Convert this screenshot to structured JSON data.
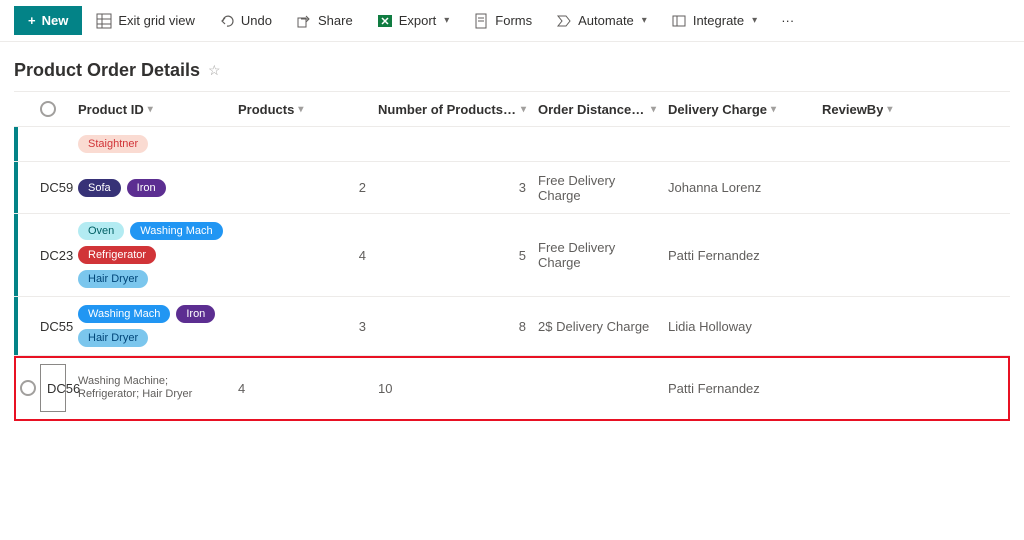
{
  "toolbar": {
    "new_label": "New",
    "exit_grid_view_label": "Exit grid view",
    "undo_label": "Undo",
    "share_label": "Share",
    "export_label": "Export",
    "forms_label": "Forms",
    "automate_label": "Automate",
    "integrate_label": "Integrate"
  },
  "heading": "Product Order Details",
  "columns": {
    "product_id": "Product ID",
    "products": "Products",
    "num_ordered": "Number of Products Ordered",
    "distance": "Order Distance Miles",
    "delivery": "Delivery Charge",
    "review_by": "ReviewBy"
  },
  "rows": [
    {
      "product_id": "",
      "chips": [
        {
          "label": "Staightner",
          "cls": "staightner"
        }
      ],
      "num_ordered": "",
      "distance": "",
      "delivery": "",
      "review_by": ""
    },
    {
      "product_id": "DC59",
      "chips": [
        {
          "label": "Sofa",
          "cls": "sofa"
        },
        {
          "label": "Iron",
          "cls": "iron"
        }
      ],
      "num_ordered": "2",
      "distance": "3",
      "delivery": "Free Delivery Charge",
      "review_by": "Johanna Lorenz"
    },
    {
      "product_id": "DC23",
      "chips": [
        {
          "label": "Oven",
          "cls": "oven"
        },
        {
          "label": "Washing Mach",
          "cls": "washing"
        },
        {
          "label": "Refrigerator",
          "cls": "refrigerator"
        },
        {
          "label": "Hair Dryer",
          "cls": "hair"
        }
      ],
      "num_ordered": "4",
      "distance": "5",
      "delivery": "Free Delivery Charge",
      "review_by": "Patti Fernandez"
    },
    {
      "product_id": "DC55",
      "chips": [
        {
          "label": "Washing Mach",
          "cls": "washing"
        },
        {
          "label": "Iron",
          "cls": "iron"
        },
        {
          "label": "Hair Dryer",
          "cls": "hair"
        }
      ],
      "num_ordered": "3",
      "distance": "8",
      "delivery": "2$ Delivery Charge",
      "review_by": "Lidia Holloway"
    }
  ],
  "edit_row": {
    "product_id": "DC56",
    "products_raw": "Washing Machine; Refrigerator; Hair Dryer",
    "num_ordered": "4",
    "distance": "10",
    "delivery": "",
    "review_by": "Patti Fernandez"
  }
}
